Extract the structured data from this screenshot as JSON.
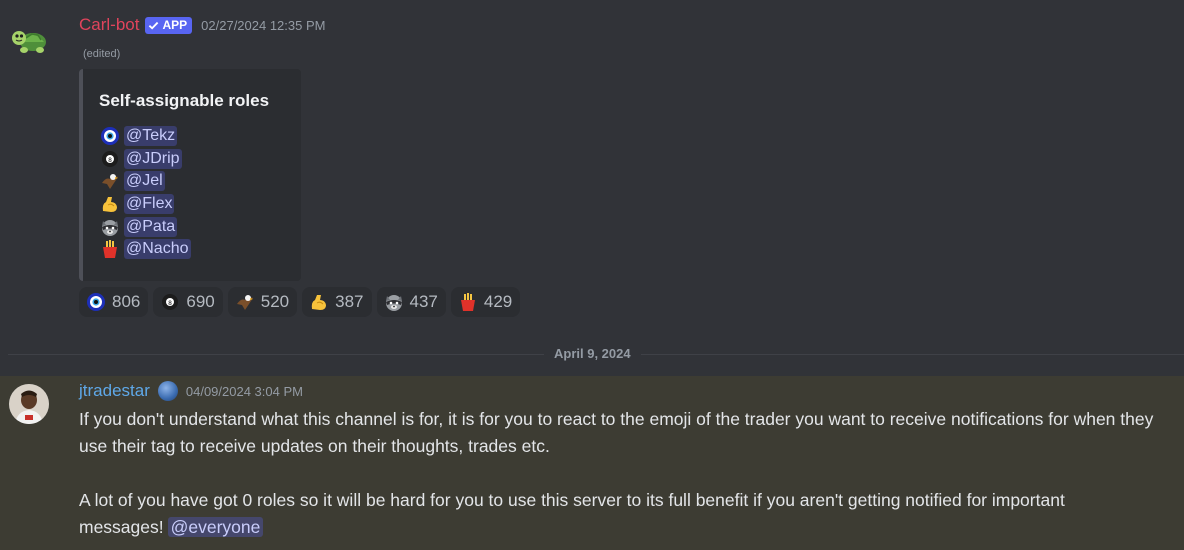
{
  "message1": {
    "username": "Carl-bot",
    "app_badge": "APP",
    "timestamp": "02/27/2024 12:35 PM",
    "edited": "(edited)",
    "embed": {
      "title": "Self-assignable roles",
      "roles": [
        {
          "emoji": "nazar-amulet",
          "mention": "@Tekz"
        },
        {
          "emoji": "8-ball",
          "mention": "@JDrip"
        },
        {
          "emoji": "eagle",
          "mention": "@Jel"
        },
        {
          "emoji": "flexed-biceps",
          "mention": "@Flex"
        },
        {
          "emoji": "raccoon",
          "mention": "@Pata"
        },
        {
          "emoji": "fries",
          "mention": "@Nacho"
        }
      ]
    },
    "reactions": [
      {
        "emoji": "nazar-amulet",
        "count": "806"
      },
      {
        "emoji": "8-ball",
        "count": "690"
      },
      {
        "emoji": "eagle",
        "count": "520"
      },
      {
        "emoji": "flexed-biceps",
        "count": "387"
      },
      {
        "emoji": "raccoon",
        "count": "437"
      },
      {
        "emoji": "fries",
        "count": "429"
      }
    ]
  },
  "divider": {
    "date": "April 9, 2024"
  },
  "message2": {
    "username": "jtradestar",
    "timestamp": "04/09/2024 3:04 PM",
    "paragraph1": "If you don't understand what this channel is for, it is for you to react to the emoji of the trader you want to receive notifications for when they use their tag to receive updates on their thoughts, trades etc.",
    "paragraph2": "A lot of you have got 0 roles so it will be hard for you to use this server to its full benefit if you aren't getting notified for important messages!",
    "mention": "@everyone"
  }
}
